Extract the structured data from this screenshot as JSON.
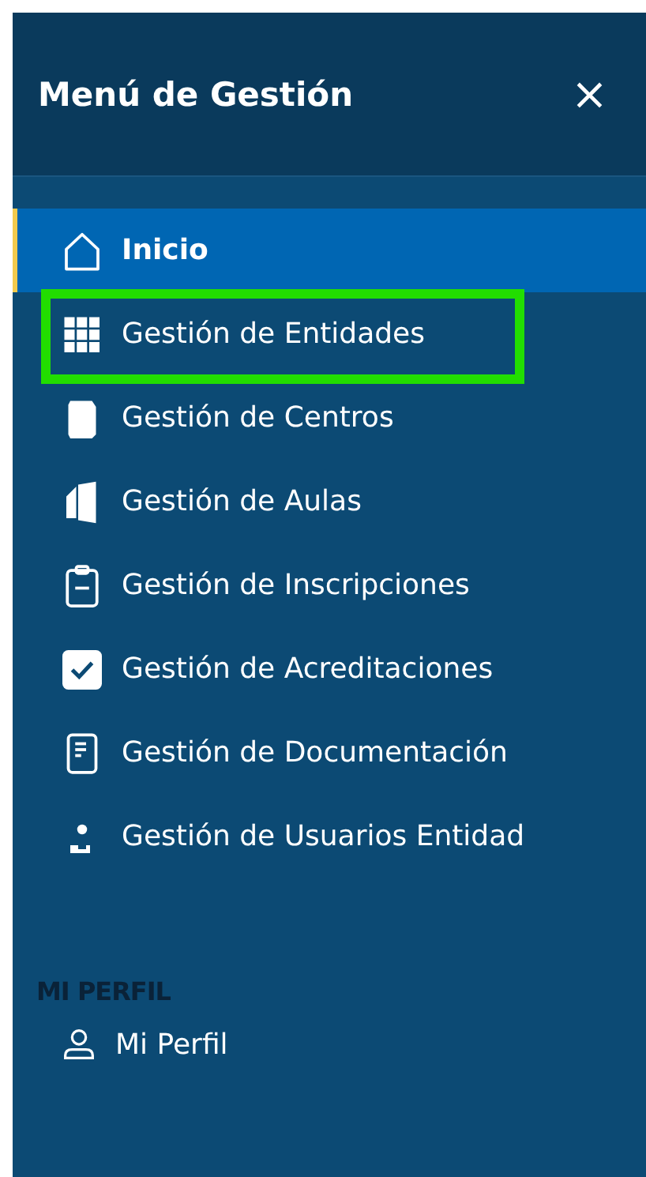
{
  "header": {
    "title": "Menú de Gestión",
    "close": "×"
  },
  "menu": [
    {
      "label": "Inicio",
      "selected": true,
      "highlighted": false
    },
    {
      "label": "Gestión de Entidades",
      "selected": false,
      "highlighted": true
    },
    {
      "label": "Gestión de Centros",
      "selected": false,
      "highlighted": false
    },
    {
      "label": "Gestión de Aulas",
      "selected": false,
      "highlighted": false
    },
    {
      "label": "Gestión de Inscripciones",
      "selected": false,
      "highlighted": false
    },
    {
      "label": "Gestión de Acreditaciones",
      "selected": false,
      "highlighted": false
    },
    {
      "label": "Gestión de Documentación",
      "selected": false,
      "highlighted": false
    },
    {
      "label": "Gestión de Usuarios Entidad",
      "selected": false,
      "highlighted": false
    }
  ],
  "profile_section": {
    "heading": "MI PERFIL",
    "items": [
      {
        "label": "Mi Perfil",
        "selected": false
      }
    ]
  }
}
